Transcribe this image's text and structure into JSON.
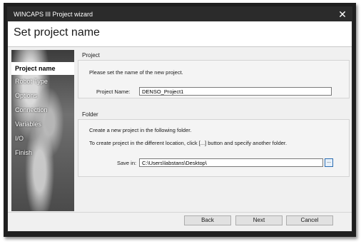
{
  "window": {
    "title": "WINCAPS III Project wizard",
    "close_symbol": "✕"
  },
  "header": {
    "title": "Set project name"
  },
  "sidebar": {
    "items": [
      {
        "label": "Project name",
        "active": true
      },
      {
        "label": "Robot Type",
        "active": false
      },
      {
        "label": "Options",
        "active": false
      },
      {
        "label": "Connection",
        "active": false
      },
      {
        "label": "Variables",
        "active": false
      },
      {
        "label": "I/O",
        "active": false
      },
      {
        "label": "Finish",
        "active": false
      }
    ]
  },
  "project_group": {
    "label": "Project",
    "instruction": "Please set the name of the new project.",
    "name_label": "Project Name:",
    "name_value": "DENSO_Project1"
  },
  "folder_group": {
    "label": "Folder",
    "line1": "Create a new project in the following folder.",
    "line2": "To create project in the different location, click [...] button and specify another folder.",
    "save_label": "Save in:",
    "save_value": "C:\\Users\\labstans\\Desktop\\",
    "browse_label": "..."
  },
  "footer": {
    "back_label": "Back",
    "next_label": "Next",
    "cancel_label": "Cancel"
  }
}
